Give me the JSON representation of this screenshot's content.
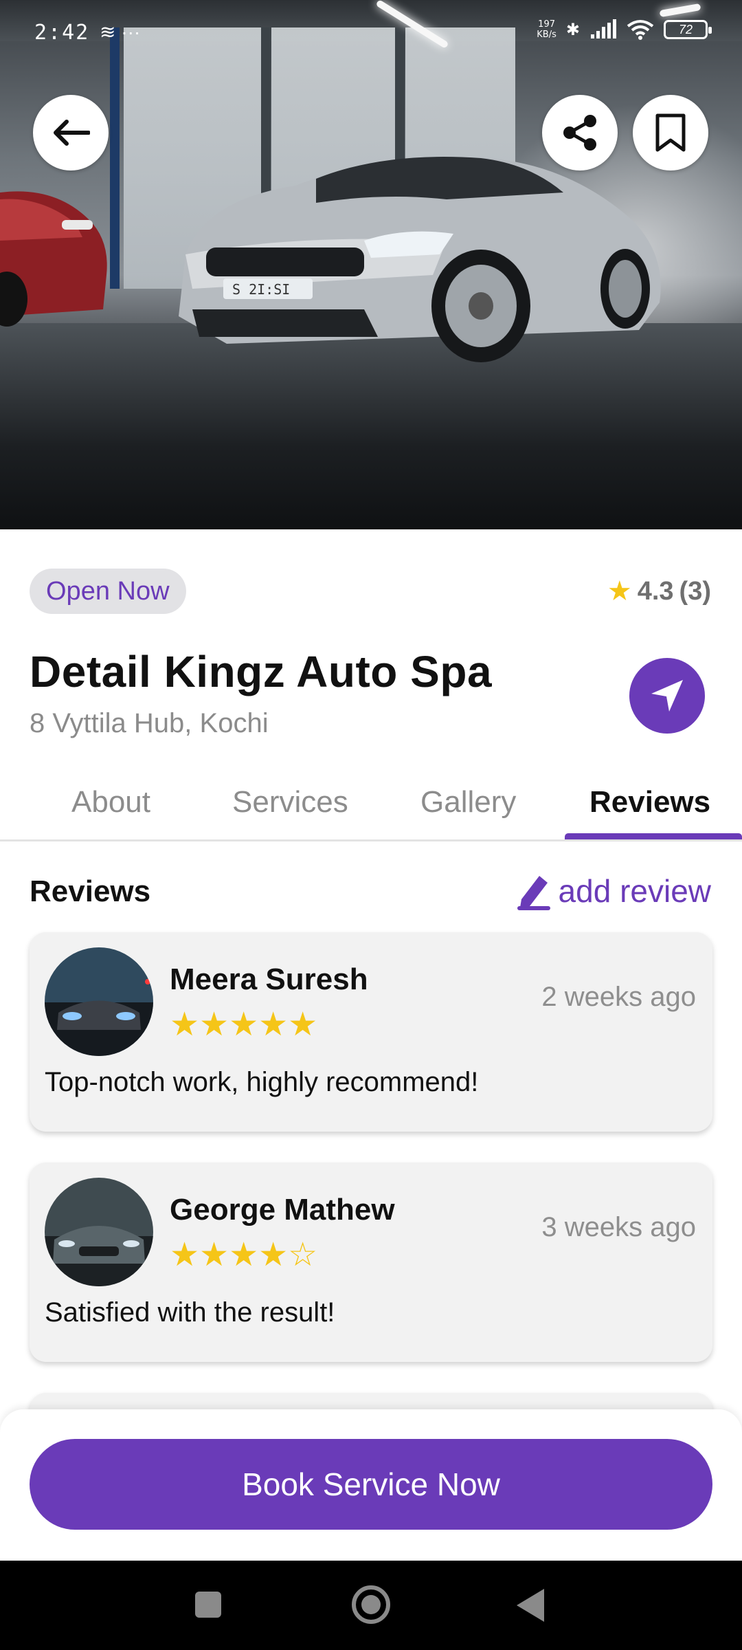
{
  "status_bar": {
    "time": "2:42",
    "left_icons": "≋ ···",
    "speed_top": "197",
    "speed_bottom": "KB/s",
    "bluetooth": "✱",
    "battery": "72"
  },
  "hero": {
    "icons": {
      "back": "arrow-left-icon",
      "share": "share-icon",
      "bookmark": "bookmark-icon"
    }
  },
  "business": {
    "status": "Open Now",
    "rating": "4.3",
    "rating_count": "(3)",
    "name": "Detail Kingz Auto Spa",
    "address": "8 Vyttila Hub, Kochi"
  },
  "tabs": [
    {
      "label": "About"
    },
    {
      "label": "Services"
    },
    {
      "label": "Gallery"
    },
    {
      "label": "Reviews"
    }
  ],
  "active_tab": "Reviews",
  "reviews_section": {
    "heading": "Reviews",
    "add_label": "add review"
  },
  "reviews": [
    {
      "name": "Meera Suresh",
      "stars": 5,
      "stars_text": "★★★★★",
      "when": "2 weeks ago",
      "comment": "Top-notch work, highly recommend!"
    },
    {
      "name": "George Mathew",
      "stars": 4,
      "stars_text": "★★★★☆",
      "when": "3 weeks ago",
      "comment": "Satisfied with the result!"
    }
  ],
  "cta": {
    "label": "Book Service Now"
  },
  "colors": {
    "accent": "#6a3bb8",
    "star": "#f5c518",
    "muted": "#8b8b8b"
  }
}
